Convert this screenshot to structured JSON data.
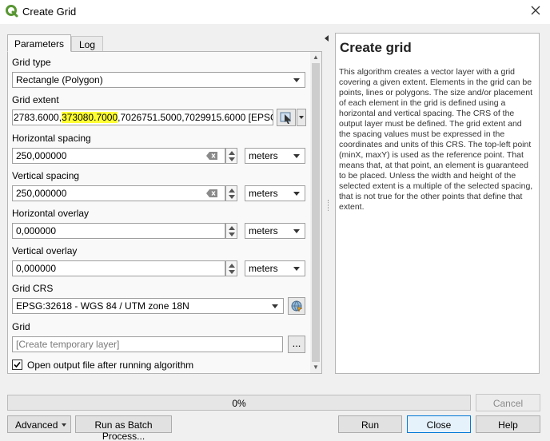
{
  "window": {
    "title": "Create Grid"
  },
  "tabs": [
    {
      "label": "Parameters"
    },
    {
      "label": "Log"
    }
  ],
  "params": {
    "grid_type": {
      "label": "Grid type",
      "value": "Rectangle (Polygon)"
    },
    "grid_extent": {
      "label": "Grid extent",
      "value_prefix": "2783.6000,",
      "value_highlight": "373080.7000",
      "value_suffix": ",7026751.5000,7029915.6000 [EPSG:326"
    },
    "h_spacing": {
      "label": "Horizontal spacing",
      "value": "250,000000",
      "unit": "meters"
    },
    "v_spacing": {
      "label": "Vertical spacing",
      "value": "250,000000",
      "unit": "meters"
    },
    "h_overlay": {
      "label": "Horizontal overlay",
      "value": "0,000000",
      "unit": "meters"
    },
    "v_overlay": {
      "label": "Vertical overlay",
      "value": "0,000000",
      "unit": "meters"
    },
    "grid_crs": {
      "label": "Grid CRS",
      "value": "EPSG:32618 - WGS 84 / UTM zone 18N"
    },
    "grid": {
      "label": "Grid",
      "placeholder": "[Create temporary layer]",
      "browse": "..."
    },
    "open_output": {
      "label": "Open output file after running algorithm",
      "checked": true
    }
  },
  "help": {
    "title": "Create grid",
    "body": "This algorithm creates a vector layer with a grid covering a given extent. Elements in the grid can be points, lines or polygons. The size and/or placement of each element in the grid is defined using a horizontal and vertical spacing. The CRS of the output layer must be defined. The grid extent and the spacing values must be expressed in the coordinates and units of this CRS. The top-left point (minX, maxY) is used as the reference point. That means that, at that point, an element is guaranteed to be placed. Unless the width and height of the selected extent is a multiple of the selected spacing, that is not true for the other points that define that extent."
  },
  "progress": {
    "value": 0,
    "label": "0%"
  },
  "buttons": {
    "cancel": "Cancel",
    "advanced": "Advanced",
    "batch": "Run as Batch Process...",
    "run": "Run",
    "close": "Close",
    "help": "Help"
  },
  "colors": {
    "highlight": "#ffff33",
    "qgis_green": "#589632"
  }
}
